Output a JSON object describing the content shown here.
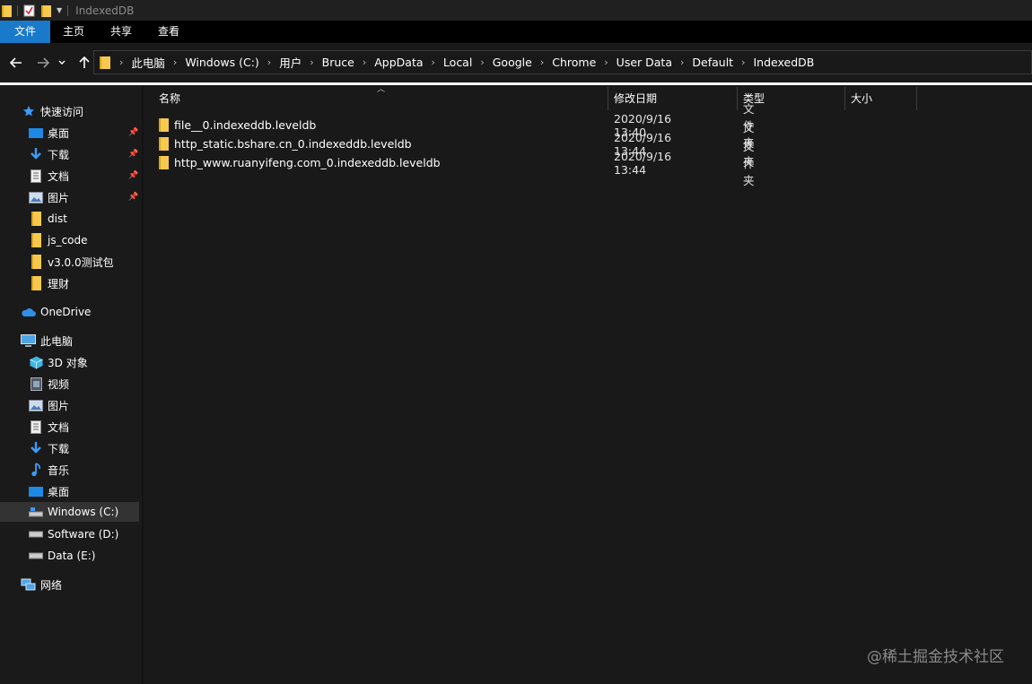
{
  "window": {
    "title": "IndexedDB"
  },
  "ribbon": {
    "tabs": [
      "文件",
      "主页",
      "共享",
      "查看"
    ]
  },
  "address": {
    "crumbs": [
      "此电脑",
      "Windows (C:)",
      "用户",
      "Bruce",
      "AppData",
      "Local",
      "Google",
      "Chrome",
      "User Data",
      "Default",
      "IndexedDB"
    ]
  },
  "sidebar": {
    "quick_access": "快速访问",
    "pinned": [
      "桌面",
      "下载",
      "文档",
      "图片"
    ],
    "folders": [
      "dist",
      "js_code",
      "v3.0.0测试包",
      "理财"
    ],
    "onedrive": "OneDrive",
    "this_pc": "此电脑",
    "pc_items": [
      "3D 对象",
      "视频",
      "图片",
      "文档",
      "下载",
      "音乐",
      "桌面"
    ],
    "drives": [
      "Windows (C:)",
      "Software (D:)",
      "Data (E:)"
    ],
    "network": "网络"
  },
  "columns": {
    "name": "名称",
    "date": "修改日期",
    "type": "类型",
    "size": "大小"
  },
  "files": [
    {
      "name": "file__0.indexeddb.leveldb",
      "date": "2020/9/16 13:40",
      "type": "文件夹"
    },
    {
      "name": "http_static.bshare.cn_0.indexeddb.leveldb",
      "date": "2020/9/16 13:44",
      "type": "文件夹"
    },
    {
      "name": "http_www.ruanyifeng.com_0.indexeddb.leveldb",
      "date": "2020/9/16 13:44",
      "type": "文件夹"
    }
  ],
  "watermark": "@稀土掘金技术社区",
  "colors": {
    "accent": "#1979ca",
    "folder": "#f6c94e",
    "background": "#191919"
  }
}
